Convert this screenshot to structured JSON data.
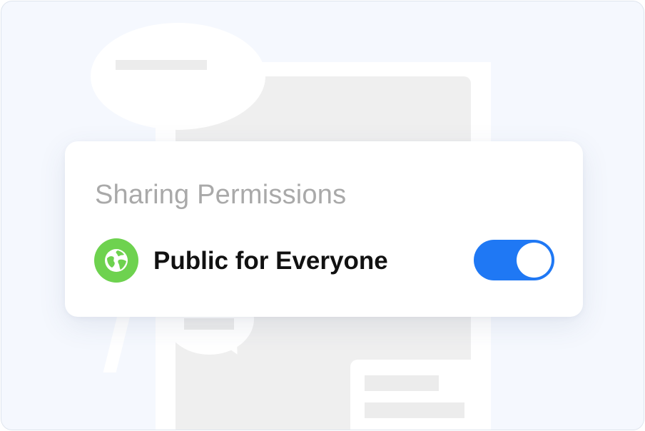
{
  "sharing_card": {
    "title": "Sharing Permissions",
    "public_label": "Public for Everyone",
    "public_icon": "globe-icon",
    "public_enabled": true
  },
  "colors": {
    "toggle_on": "#1f78f4",
    "globe_badge": "#6ed24f",
    "title_text": "#a9a9a9",
    "label_text": "#111111",
    "background": "#f5f8fe"
  }
}
